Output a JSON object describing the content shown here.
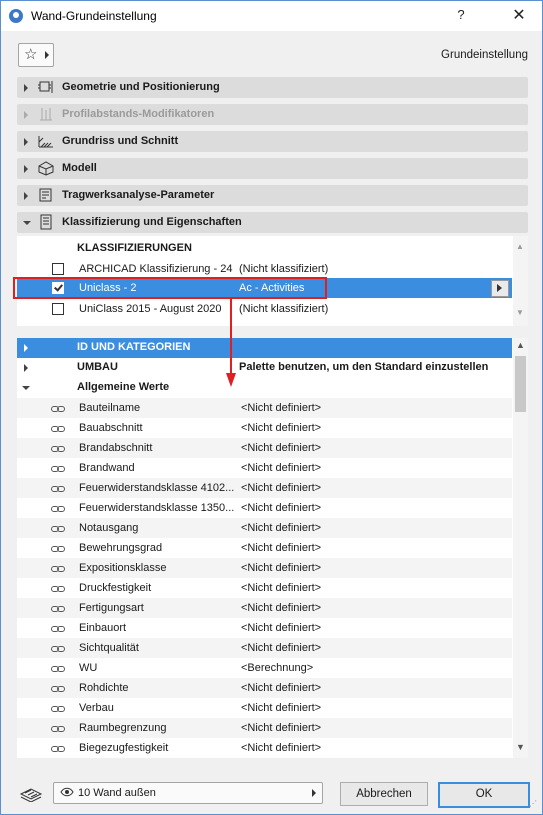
{
  "window": {
    "title": "Wand-Grundeinstellung",
    "help": "?",
    "close": "✕"
  },
  "toolbar": {
    "default_label": "Grundeinstellung"
  },
  "panels": [
    {
      "label": "Geometrie und Positionierung",
      "icon": "geometry-icon",
      "expanded": false,
      "disabled": false
    },
    {
      "label": "Profilabstands-Modifikatoren",
      "icon": "profile-modifier-icon",
      "expanded": false,
      "disabled": true
    },
    {
      "label": "Grundriss und Schnitt",
      "icon": "floorplan-section-icon",
      "expanded": false,
      "disabled": false
    },
    {
      "label": "Modell",
      "icon": "model-box-icon",
      "expanded": false,
      "disabled": false
    },
    {
      "label": "Tragwerksanalyse-Parameter",
      "icon": "structural-analysis-icon",
      "expanded": false,
      "disabled": false
    },
    {
      "label": "Klassifizierung und Eigenschaften",
      "icon": "classification-icon",
      "expanded": true,
      "disabled": false
    }
  ],
  "classifications": {
    "header": "KLASSIFIZIERUNGEN",
    "rows": [
      {
        "name": "ARCHICAD Klassifizierung - 24",
        "value": "(Nicht klassifiziert)",
        "checked": false,
        "selected": false
      },
      {
        "name": "Uniclass - 2",
        "value": "Ac - Activities",
        "checked": true,
        "selected": true
      },
      {
        "name": "UniClass 2015 - August 2020",
        "value": "(Nicht klassifiziert)",
        "checked": false,
        "selected": false
      }
    ]
  },
  "properties": {
    "groups": [
      {
        "name": "ID UND KATEGORIEN",
        "value": "",
        "expanded": false,
        "highlighted": true
      },
      {
        "name": "UMBAU",
        "value": "Palette benutzen, um den Standard einzustellen",
        "expanded": false,
        "highlighted": false
      },
      {
        "name": "Allgemeine Werte",
        "value": "",
        "expanded": true,
        "highlighted": false
      }
    ],
    "items": [
      {
        "name": "Bauteilname",
        "value": "<Nicht definiert>"
      },
      {
        "name": "Bauabschnitt",
        "value": "<Nicht definiert>"
      },
      {
        "name": "Brandabschnitt",
        "value": "<Nicht definiert>"
      },
      {
        "name": "Brandwand",
        "value": "<Nicht definiert>"
      },
      {
        "name": "Feuerwiderstandsklasse 4102...",
        "value": "<Nicht definiert>"
      },
      {
        "name": "Feuerwiderstandsklasse 1350...",
        "value": "<Nicht definiert>"
      },
      {
        "name": "Notausgang",
        "value": "<Nicht definiert>"
      },
      {
        "name": "Bewehrungsgrad",
        "value": "<Nicht definiert>"
      },
      {
        "name": "Expositionsklasse",
        "value": "<Nicht definiert>"
      },
      {
        "name": "Druckfestigkeit",
        "value": "<Nicht definiert>"
      },
      {
        "name": "Fertigungsart",
        "value": "<Nicht definiert>"
      },
      {
        "name": "Einbauort",
        "value": "<Nicht definiert>"
      },
      {
        "name": "Sichtqualität",
        "value": "<Nicht definiert>"
      },
      {
        "name": "WU",
        "value": "<Berechnung>"
      },
      {
        "name": "Rohdichte",
        "value": "<Nicht definiert>"
      },
      {
        "name": "Verbau",
        "value": "<Nicht definiert>"
      },
      {
        "name": "Raumbegrenzung",
        "value": "<Nicht definiert>"
      },
      {
        "name": "Biegezugfestigkeit",
        "value": "<Nicht definiert>"
      }
    ]
  },
  "footer": {
    "layer": "10 Wand außen",
    "cancel": "Abbrechen",
    "ok": "OK"
  },
  "colors": {
    "selection": "#3b8de0",
    "annotation_red": "#e02020"
  }
}
